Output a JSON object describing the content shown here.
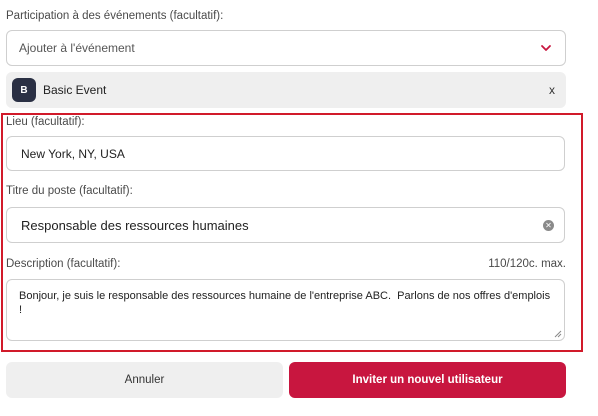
{
  "event": {
    "label": "Participation à des événements (facultatif):",
    "select_placeholder": "Ajouter à l'événement",
    "chip_initial": "B",
    "chip_name": "Basic Event",
    "chip_remove": "x"
  },
  "location": {
    "label": "Lieu (facultatif):",
    "value": "New York, NY, USA"
  },
  "job_title": {
    "label": "Titre du poste (facultatif):",
    "value": "Responsable des ressources humaines"
  },
  "description": {
    "label": "Description (facultatif):",
    "counter": "110/120c. max.",
    "value": "Bonjour, je suis le responsable des ressources humaine de l'entreprise ABC.  Parlons de nos offres d'emplois !"
  },
  "buttons": {
    "cancel": "Annuler",
    "invite": "Inviter un nouvel utilisateur"
  },
  "colors": {
    "accent": "#c8163f",
    "highlight": "#d11a2a",
    "badge": "#2a3044"
  },
  "icons": {
    "select": "chevron-down-icon",
    "clear": "clear-icon",
    "resize": "resize-handle-icon"
  }
}
